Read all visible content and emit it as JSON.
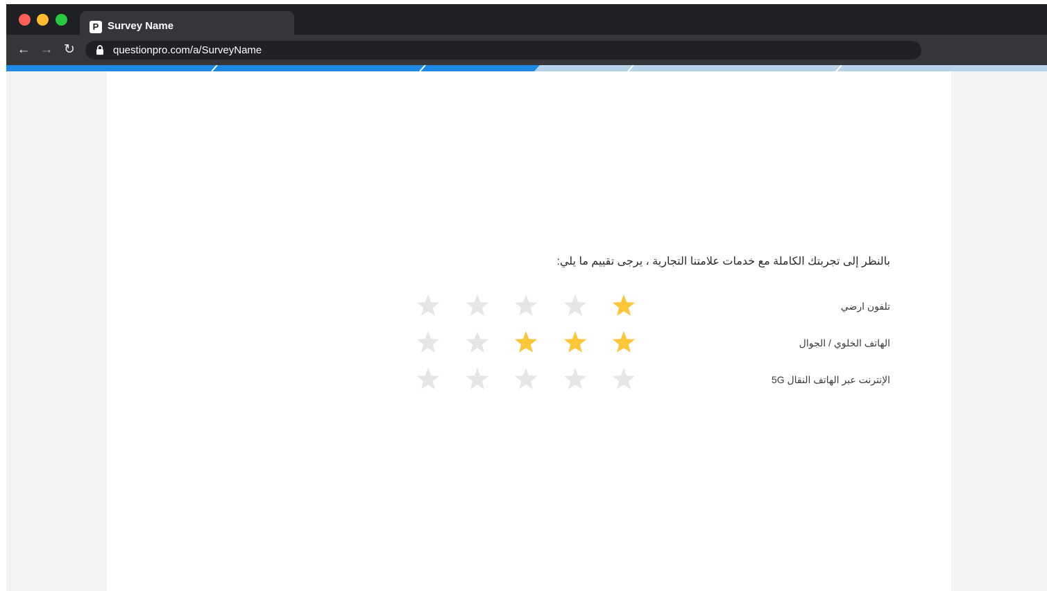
{
  "browser": {
    "tab_title": "Survey Name",
    "favicon_letter": "P",
    "url": "questionpro.com/a/SurveyName",
    "icons": [
      "back-arrow-icon",
      "forward-arrow-icon",
      "reload-icon",
      "lock-icon"
    ]
  },
  "progress": {
    "completed_fraction": 0.51,
    "segments": 5,
    "filled_color": "#1e88e5",
    "empty_color": "#b7d3ea"
  },
  "survey": {
    "question": "بالنظر إلى تجربتك الكاملة مع خدمات علامتنا التجارية ، يرجى تقييم ما يلي:",
    "max_rating": 5,
    "rows": [
      {
        "label": "تلفون ارضي",
        "rating": 1
      },
      {
        "label": "الهاتف الخلوي / الجوال",
        "rating": 3
      },
      {
        "label": "الإنترنت عبر الهاتف النقال 5G",
        "rating": 0
      }
    ],
    "colors": {
      "star_filled": "#fcc63a",
      "star_empty": "#e6e6e6"
    }
  }
}
